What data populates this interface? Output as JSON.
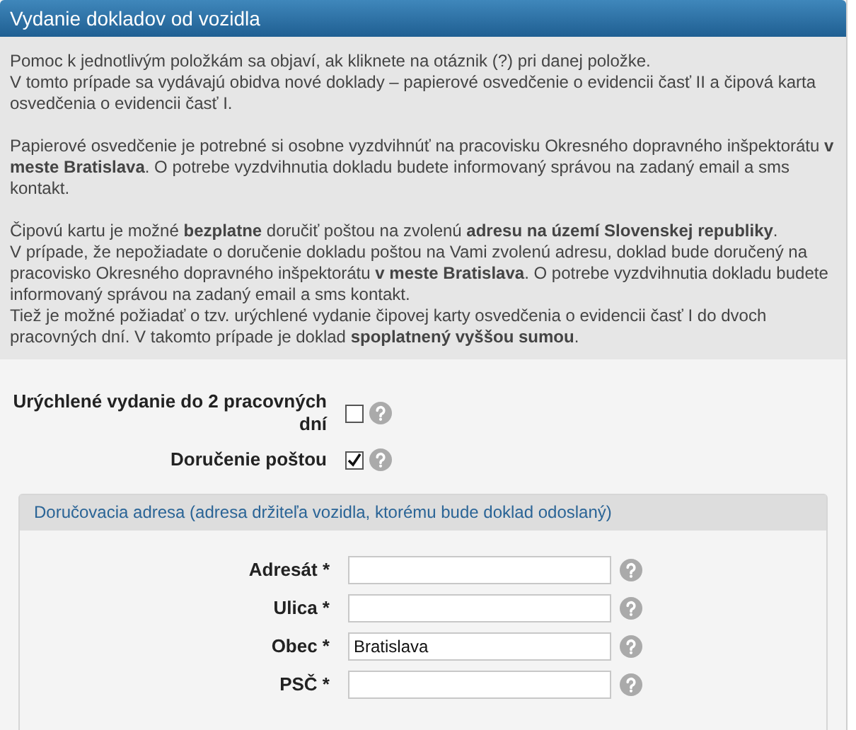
{
  "header": {
    "title": "Vydanie dokladov od vozidla"
  },
  "info": [
    [
      "Pomoc k jednotlivým položkám sa objaví, ak kliknete na otáznik (?) pri danej položke.",
      "V tomto prípade sa vydávajú obidva nové doklady – papierové osvedčenie o evidencii časť II a čipová karta osvedčenia o evidencii časť I."
    ],
    [
      "Papierové osvedčenie je potrebné si osobne vyzdvihnúť na pracovisku Okresného dopravného inšpektorátu **v meste Bratislava**. O potrebe vyzdvihnutia dokladu budete informovaný správou na zadaný email a sms kontakt."
    ],
    [
      "Čipovú kartu je možné **bezplatne** doručiť poštou na zvolenú **adresu na území Slovenskej republiky**.",
      "V prípade, že nepožiadate o doručenie dokladu poštou na Vami zvolenú adresu, doklad bude doručený na pracovisko Okresného dopravného inšpektorátu **v meste Bratislava**. O potrebe vyzdvihnutia dokladu budete informovaný správou na zadaný email a sms kontakt.",
      "Tiež je možné požiadať o tzv. urýchlené vydanie čipovej karty osvedčenia o evidencii časť I do dvoch pracovných dní. V takomto prípade je doklad **spoplatnený vyššou sumou**."
    ]
  ],
  "options": [
    {
      "label": "Urýchlené vydanie do 2 pracovných dní",
      "checked": false
    },
    {
      "label": "Doručenie poštou",
      "checked": true
    }
  ],
  "address": {
    "title": "Doručovacia adresa (adresa držiteľa vozidla, ktorému bude doklad odoslaný)",
    "fields": [
      {
        "label": "Adresát *"
      },
      {
        "label": "Ulica *"
      },
      {
        "label": "Obec *",
        "value": "Bratislava"
      },
      {
        "label": "PSČ *"
      }
    ]
  }
}
